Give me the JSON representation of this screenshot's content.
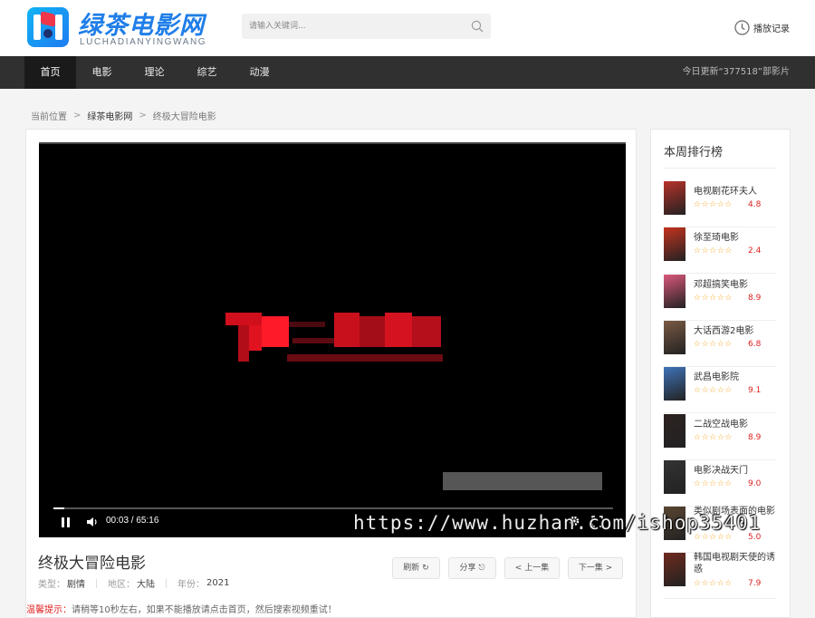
{
  "site": {
    "title": "绿茶电影网",
    "subtitle": "LUCHADIANYINGWANG"
  },
  "search": {
    "placeholder": "请输入关键词..."
  },
  "history": {
    "label": "播放记录"
  },
  "nav": {
    "items": [
      {
        "label": "首页",
        "active": true
      },
      {
        "label": "电影"
      },
      {
        "label": "理论"
      },
      {
        "label": "综艺"
      },
      {
        "label": "动漫"
      }
    ],
    "update_text": "今日更新“377518”部影片"
  },
  "breadcrumb": {
    "prefix": "当前位置",
    "home": "绿茶电影网",
    "current": "终极大冒险电影"
  },
  "player": {
    "time": "00:03 / 65:16",
    "progress": 0.02,
    "watermark": "https://www.huzhan.com/ishop35401"
  },
  "movie": {
    "title": "终极大冒险电影",
    "type_label": "类型：",
    "type": "剧情",
    "region_label": "地区：",
    "region": "大陆",
    "year_label": "年份：",
    "year": "2021"
  },
  "buttons": {
    "refresh": "刷新",
    "share": "分享",
    "prev": "上一集",
    "next": "下一集"
  },
  "tip": {
    "label": "温馨提示：",
    "text": "请稍等10秒左右，如果不能播放请点击首页，然后搜索视频重试！"
  },
  "sidebar": {
    "title": "本周排行榜",
    "items": [
      {
        "name": "电视剧花环夫人",
        "stars": "☆☆☆☆☆",
        "score": "4.8",
        "color": "#b8322a"
      },
      {
        "name": "徐至琦电影",
        "stars": "☆☆☆☆☆",
        "score": "2.4",
        "color": "#c4331f"
      },
      {
        "name": "邓超搞笑电影",
        "stars": "☆☆☆☆☆",
        "score": "8.9",
        "color": "#d9587a"
      },
      {
        "name": "大话西游2电影",
        "stars": "☆☆☆☆☆",
        "score": "6.8",
        "color": "#7a5a44"
      },
      {
        "name": "武昌电影院",
        "stars": "☆☆☆☆☆",
        "score": "9.1",
        "color": "#3f73b8"
      },
      {
        "name": "二战空战电影",
        "stars": "☆☆☆☆☆",
        "score": "8.9",
        "color": "#2c2220"
      },
      {
        "name": "电影决战天门",
        "stars": "☆☆☆☆☆",
        "score": "9.0",
        "color": "#333333"
      },
      {
        "name": "类似剧场表面的电影",
        "stars": "☆☆☆☆☆",
        "score": "5.0",
        "color": "#5a4632"
      },
      {
        "name": "韩国电视剧天使的诱惑",
        "stars": "☆☆☆☆☆",
        "score": "7.9",
        "color": "#6e2a1e"
      }
    ]
  }
}
